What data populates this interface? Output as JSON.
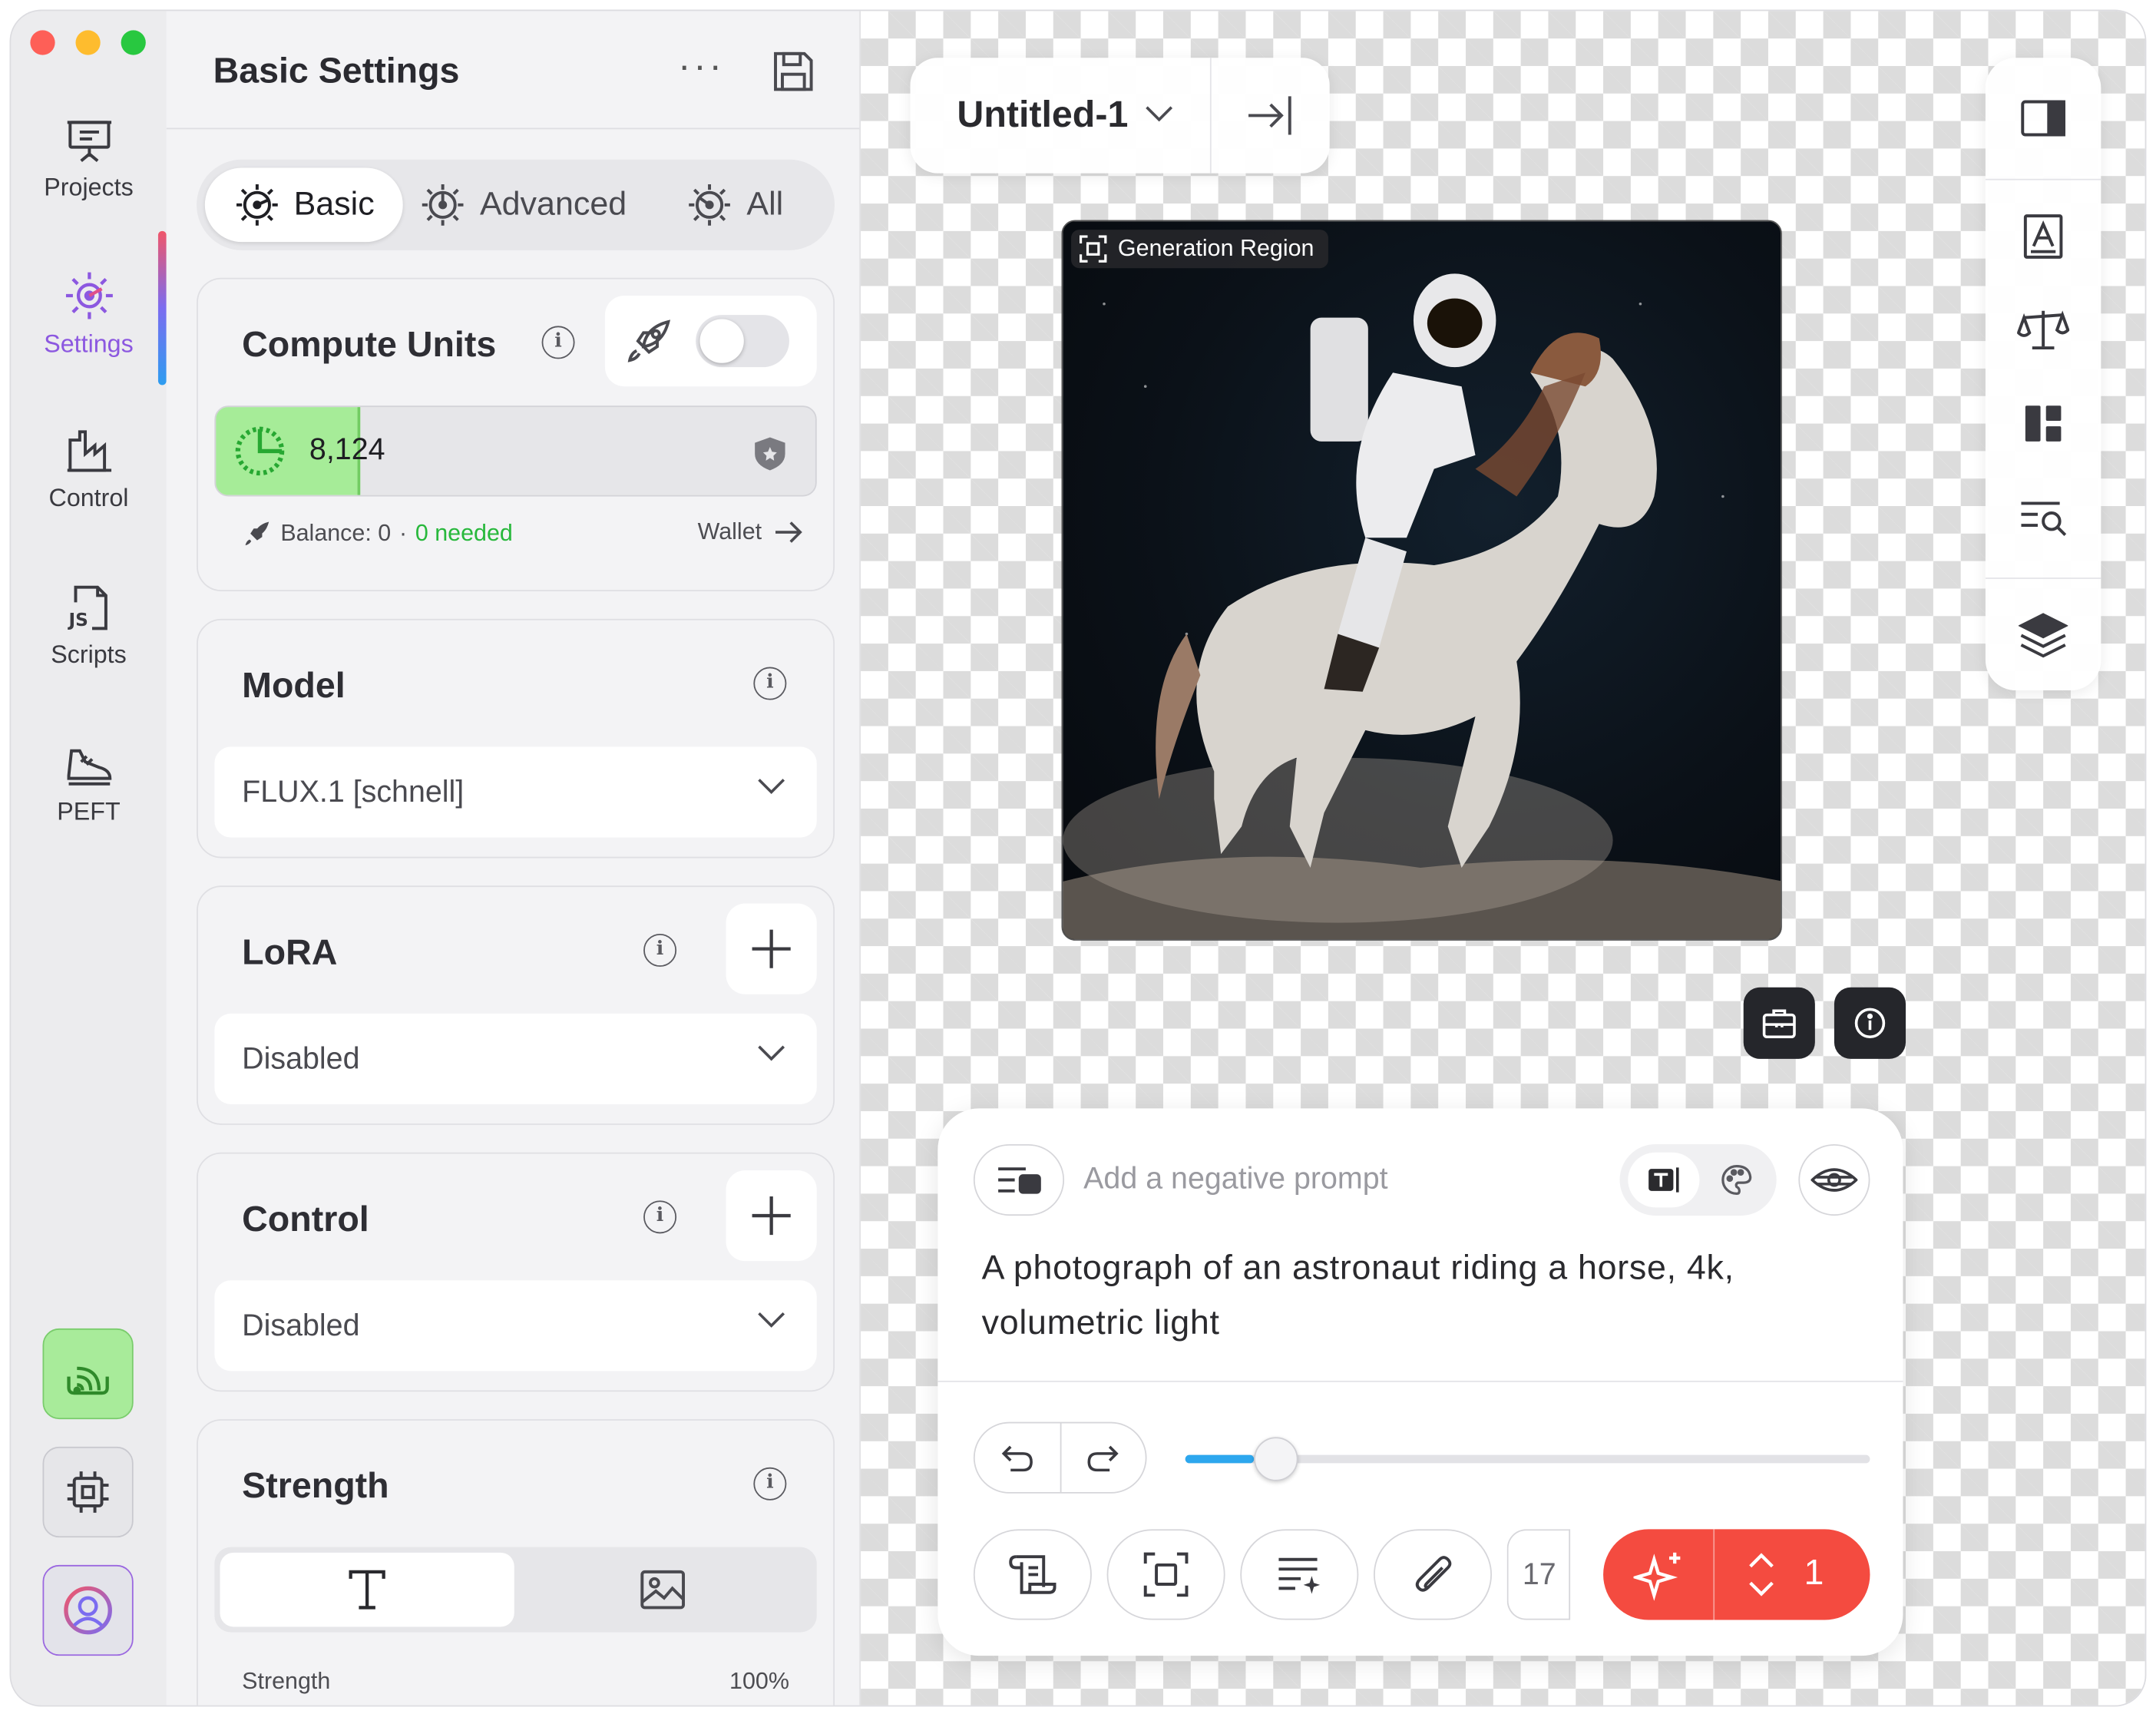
{
  "rail": {
    "items": [
      {
        "label": "Projects",
        "icon": "presentation-icon"
      },
      {
        "label": "Settings",
        "icon": "settings-sun-icon"
      },
      {
        "label": "Control",
        "icon": "factory-icon"
      },
      {
        "label": "Scripts",
        "icon": "js-file-icon"
      },
      {
        "label": "PEFT",
        "icon": "sneaker-icon"
      }
    ],
    "active_color": "#8c58e0"
  },
  "panel": {
    "title": "Basic Settings",
    "tabs": [
      {
        "label": "Basic",
        "active": true
      },
      {
        "label": "Advanced",
        "active": false
      },
      {
        "label": "All",
        "active": false
      }
    ],
    "compute_units": {
      "title": "Compute Units",
      "value": "8,124",
      "level": 0.24,
      "balance": "Balance: 0",
      "separator": "·",
      "needed": "0 needed",
      "wallet": "Wallet",
      "boost_enabled": false
    },
    "model": {
      "title": "Model",
      "value": "FLUX.1 [schnell]"
    },
    "lora": {
      "title": "LoRA",
      "value": "Disabled"
    },
    "control": {
      "title": "Control",
      "value": "Disabled"
    },
    "strength": {
      "title": "Strength",
      "label": "Strength",
      "value": "100%"
    }
  },
  "canvas": {
    "doc_title": "Untitled-1",
    "generation_region": "Generation Region"
  },
  "prompt": {
    "negative_placeholder": "Add a negative prompt",
    "text": "A photograph of an astronaut riding a horse, 4k, volumetric light",
    "steps": "17",
    "slider_value": 0.1,
    "generate_count": "1"
  },
  "colors": {
    "accent_green": "#28b83c",
    "generate_red": "#f44b40",
    "slider_blue": "#2da7ee"
  }
}
